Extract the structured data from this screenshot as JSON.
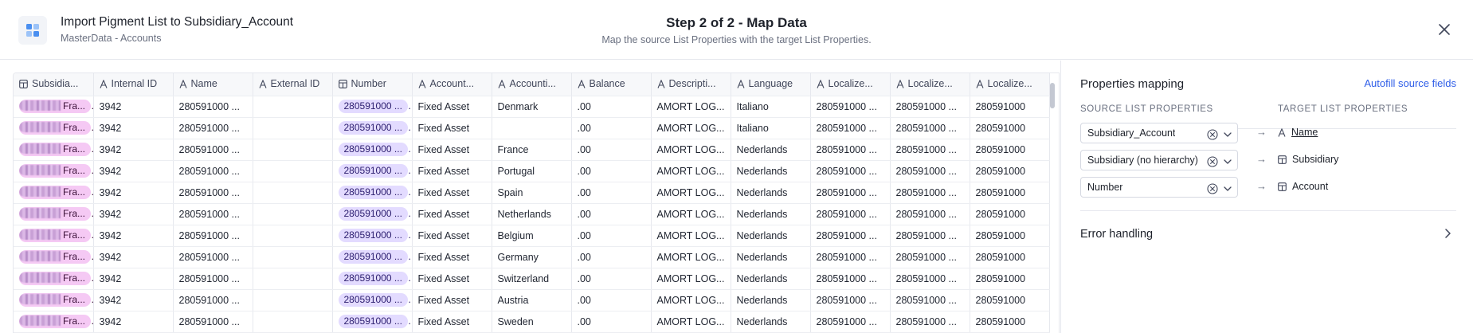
{
  "header": {
    "title": "Import Pigment List to Subsidiary_Account",
    "subtitle": "MasterData - Accounts",
    "step_title": "Step 2 of 2 - Map Data",
    "step_description": "Map the source List Properties with the target List Properties."
  },
  "table": {
    "columns": [
      {
        "label": "Subsidia...",
        "icon": "grid-icon"
      },
      {
        "label": "Internal ID",
        "icon": "text-type-icon"
      },
      {
        "label": "Name",
        "icon": "text-type-icon"
      },
      {
        "label": "External ID",
        "icon": "text-type-icon"
      },
      {
        "label": "Number",
        "icon": "grid-icon"
      },
      {
        "label": "Account...",
        "icon": "text-type-icon"
      },
      {
        "label": "Accounti...",
        "icon": "text-type-icon"
      },
      {
        "label": "Balance",
        "icon": "text-type-icon"
      },
      {
        "label": "Descripti...",
        "icon": "text-type-icon"
      },
      {
        "label": "Language",
        "icon": "text-type-icon"
      },
      {
        "label": "Localize...",
        "icon": "text-type-icon"
      },
      {
        "label": "Localize...",
        "icon": "text-type-icon"
      },
      {
        "label": "Localize...",
        "icon": "text-type-icon"
      }
    ],
    "rows": [
      [
        "Fra...",
        "3942",
        "280591000 ...",
        "",
        "280591000 ...",
        "Fixed Asset",
        "Denmark",
        ".00",
        "AMORT LOG...",
        "Italiano",
        "280591000 ...",
        "280591000 ...",
        "280591000"
      ],
      [
        "Fra...",
        "3942",
        "280591000 ...",
        "",
        "280591000 ...",
        "Fixed Asset",
        "",
        ".00",
        "AMORT LOG...",
        "Italiano",
        "280591000 ...",
        "280591000 ...",
        "280591000"
      ],
      [
        "Fra...",
        "3942",
        "280591000 ...",
        "",
        "280591000 ...",
        "Fixed Asset",
        "France",
        ".00",
        "AMORT LOG...",
        "Nederlands",
        "280591000 ...",
        "280591000 ...",
        "280591000"
      ],
      [
        "Fra...",
        "3942",
        "280591000 ...",
        "",
        "280591000 ...",
        "Fixed Asset",
        "Portugal",
        ".00",
        "AMORT LOG...",
        "Nederlands",
        "280591000 ...",
        "280591000 ...",
        "280591000"
      ],
      [
        "Fra...",
        "3942",
        "280591000 ...",
        "",
        "280591000 ...",
        "Fixed Asset",
        "Spain",
        ".00",
        "AMORT LOG...",
        "Nederlands",
        "280591000 ...",
        "280591000 ...",
        "280591000"
      ],
      [
        "Fra...",
        "3942",
        "280591000 ...",
        "",
        "280591000 ...",
        "Fixed Asset",
        "Netherlands",
        ".00",
        "AMORT LOG...",
        "Nederlands",
        "280591000 ...",
        "280591000 ...",
        "280591000"
      ],
      [
        "Fra...",
        "3942",
        "280591000 ...",
        "",
        "280591000 ...",
        "Fixed Asset",
        "Belgium",
        ".00",
        "AMORT LOG...",
        "Nederlands",
        "280591000 ...",
        "280591000 ...",
        "280591000"
      ],
      [
        "Fra...",
        "3942",
        "280591000 ...",
        "",
        "280591000 ...",
        "Fixed Asset",
        "Germany",
        ".00",
        "AMORT LOG...",
        "Nederlands",
        "280591000 ...",
        "280591000 ...",
        "280591000"
      ],
      [
        "Fra...",
        "3942",
        "280591000 ...",
        "",
        "280591000 ...",
        "Fixed Asset",
        "Switzerland",
        ".00",
        "AMORT LOG...",
        "Nederlands",
        "280591000 ...",
        "280591000 ...",
        "280591000"
      ],
      [
        "Fra...",
        "3942",
        "280591000 ...",
        "",
        "280591000 ...",
        "Fixed Asset",
        "Austria",
        ".00",
        "AMORT LOG...",
        "Nederlands",
        "280591000 ...",
        "280591000 ...",
        "280591000"
      ],
      [
        "Fra...",
        "3942",
        "280591000 ...",
        "",
        "280591000 ...",
        "Fixed Asset",
        "Sweden",
        ".00",
        "AMORT LOG...",
        "Nederlands",
        "280591000 ...",
        "280591000 ...",
        "280591000"
      ]
    ]
  },
  "panel": {
    "title": "Properties mapping",
    "autofill_label": "Autofill source fields",
    "source_header": "SOURCE LIST PROPERTIES",
    "target_header": "TARGET LIST PROPERTIES",
    "arrow": "→",
    "mappings": [
      {
        "source": "Subsidiary_Account",
        "target": "Name",
        "target_icon": "text-type-icon",
        "underline": true
      },
      {
        "source": "Subsidiary (no hierarchy)",
        "target": "Subsidiary",
        "target_icon": "grid-icon",
        "underline": false
      },
      {
        "source": "Number",
        "target": "Account",
        "target_icon": "grid-icon",
        "underline": false
      }
    ],
    "error_handling_label": "Error handling"
  },
  "colors": {
    "accent": "#2f5ee8",
    "pill_purple": "#e3dbff",
    "pill_pink": "#f5c9f4",
    "border": "#e6e8ee"
  }
}
